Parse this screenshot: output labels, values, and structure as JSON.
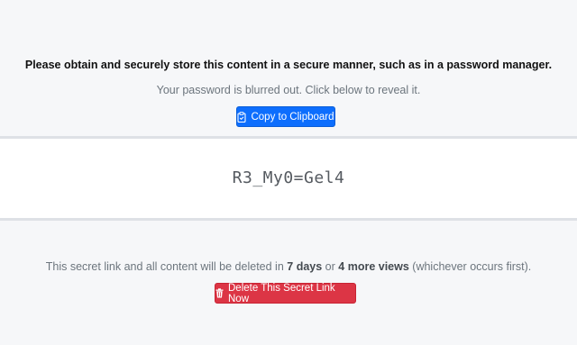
{
  "notice": {
    "instruction": "Please obtain and securely store this content in a secure manner, such as in a password manager.",
    "blur_hint": "Your password is blurred out. Click below to reveal it.",
    "copy_button_label": "Copy to Clipboard"
  },
  "secret": {
    "value": "R3_My0=Gel4"
  },
  "expiry": {
    "prefix": "This secret link and all content will be deleted in",
    "days": "7 days",
    "connector": "or",
    "views": "4 more views",
    "suffix": "(whichever occurs first).",
    "delete_button_label": "Delete This Secret Link Now"
  },
  "colors": {
    "primary": "#0d6efd",
    "danger": "#dc3545",
    "background": "#f6f7f9"
  },
  "icons": {
    "copy": "clipboard-icon",
    "delete": "trash-icon"
  }
}
